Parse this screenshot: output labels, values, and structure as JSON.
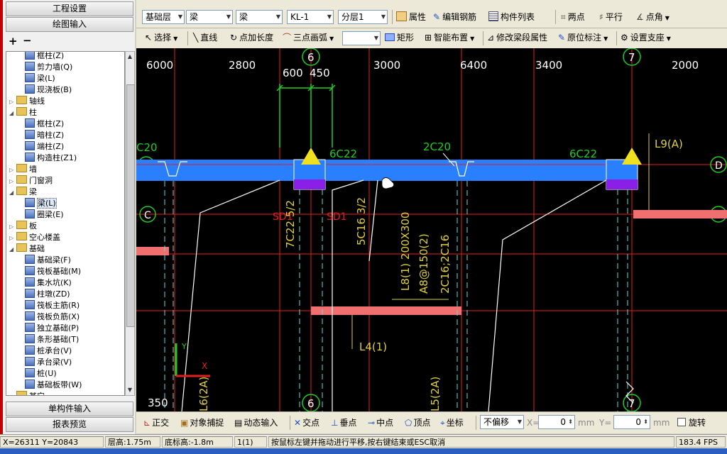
{
  "left_panel": {
    "top_buttons": [
      "工程设置",
      "绘图输入"
    ],
    "add_icon": "+",
    "remove_icon": "−",
    "bottom_buttons": [
      "单构件输入",
      "报表预览"
    ],
    "tree": [
      {
        "label": "框柱(Z)",
        "level": 2,
        "icon": "column-icon"
      },
      {
        "label": "剪力墙(Q)",
        "level": 2,
        "icon": "wall-icon"
      },
      {
        "label": "梁(L)",
        "level": 2,
        "icon": "beam-icon"
      },
      {
        "label": "现浇板(B)",
        "level": 2,
        "icon": "slab-icon"
      },
      {
        "label": "轴线",
        "level": 1,
        "icon": "folder-icon",
        "toggle": "▷"
      },
      {
        "label": "柱",
        "level": 1,
        "icon": "folder-icon",
        "toggle": "◢"
      },
      {
        "label": "框柱(Z)",
        "level": 2,
        "icon": "column-icon"
      },
      {
        "label": "暗柱(Z)",
        "level": 2,
        "icon": "column-icon"
      },
      {
        "label": "端柱(Z)",
        "level": 2,
        "icon": "column-icon"
      },
      {
        "label": "构造柱(Z1)",
        "level": 2,
        "icon": "column-icon"
      },
      {
        "label": "墙",
        "level": 1,
        "icon": "folder-icon",
        "toggle": "▷"
      },
      {
        "label": "门窗洞",
        "level": 1,
        "icon": "folder-icon",
        "toggle": "▷"
      },
      {
        "label": "梁",
        "level": 1,
        "icon": "folder-icon",
        "toggle": "◢"
      },
      {
        "label": "梁(L)",
        "level": 2,
        "icon": "beam-icon",
        "selected": true
      },
      {
        "label": "圈梁(E)",
        "level": 2,
        "icon": "beam-icon"
      },
      {
        "label": "板",
        "level": 1,
        "icon": "folder-icon",
        "toggle": "▷"
      },
      {
        "label": "空心楼盖",
        "level": 1,
        "icon": "folder-icon",
        "toggle": "▷"
      },
      {
        "label": "基础",
        "level": 1,
        "icon": "folder-icon",
        "toggle": "◢"
      },
      {
        "label": "基础梁(F)",
        "level": 2,
        "icon": "grid-icon"
      },
      {
        "label": "筏板基础(M)",
        "level": 2,
        "icon": "grid-icon"
      },
      {
        "label": "集水坑(K)",
        "level": 2,
        "icon": "pit-icon"
      },
      {
        "label": "柱墩(ZD)",
        "level": 2,
        "icon": "pier-icon"
      },
      {
        "label": "筏板主筋(R)",
        "level": 2,
        "icon": "grid-icon"
      },
      {
        "label": "筏板负筋(X)",
        "level": 2,
        "icon": "grid-icon"
      },
      {
        "label": "独立基础(P)",
        "level": 2,
        "icon": "footing-icon"
      },
      {
        "label": "条形基础(T)",
        "level": 2,
        "icon": "strip-icon"
      },
      {
        "label": "桩承台(V)",
        "level": 2,
        "icon": "cap-icon"
      },
      {
        "label": "承台梁(V)",
        "level": 2,
        "icon": "beam-icon"
      },
      {
        "label": "桩(U)",
        "level": 2,
        "icon": "pile-icon"
      },
      {
        "label": "基础板带(W)",
        "level": 2,
        "icon": "grid-icon"
      },
      {
        "label": "其它",
        "level": 1,
        "icon": "folder-icon",
        "toggle": "▷"
      }
    ]
  },
  "toolbar1": {
    "floor": "基础层",
    "category": "梁",
    "type": "梁",
    "component": "KL-1",
    "layer": "分层1",
    "btn_props": "属性",
    "btn_edit_rebar": "编辑钢筋",
    "btn_list": "构件列表",
    "btn_two_point": "两点",
    "btn_parallel": "平行",
    "btn_point_angle": "点角"
  },
  "toolbar2": {
    "select": "选择",
    "line": "直线",
    "point_length": "点加长度",
    "arc": "三点画弧",
    "rect": "矩形",
    "smart": "智能布置",
    "modify_seg": "修改梁段属性",
    "in_place": "原位标注",
    "support": "设置支座"
  },
  "canvas": {
    "dims_top": [
      "6000",
      "2800",
      "600",
      "450",
      "3000",
      "6400",
      "3400",
      "2000"
    ],
    "axis_6": "6",
    "axis_7": "7",
    "axis_D": "D",
    "axis_C": "C",
    "labels": {
      "c20_left": "C20",
      "c6c22_a": "6C22",
      "c2c20": "2C20",
      "c6c22_b": "6C22",
      "l9": "L9(A)",
      "sd1_a": "SD1",
      "sd1_b": "SD1",
      "r7c22": "7C22 5/2",
      "r5c16": "5C16 3/2",
      "l8_a": "L8(1) 200X300",
      "l8_b": "A8@150(2)",
      "l8_c": "2C16;2C16",
      "l4": "L4(1)",
      "l6": "L6(2A)",
      "l5": "L5(2A)",
      "n350": "350",
      "ucs_y": "Y",
      "ucs_x": "X"
    }
  },
  "snapbar": {
    "ortho": "正交",
    "obj_snap": "对象捕捉",
    "dyn_input": "动态输入",
    "intersect": "交点",
    "perp": "垂点",
    "mid": "中点",
    "vertex": "顶点",
    "coord": "坐标",
    "offset": "不偏移",
    "x_label": "X=",
    "x_val": "0",
    "mm1": "mm",
    "y_label": "Y=",
    "y_val": "0",
    "mm2": "mm",
    "rotate": "旋转"
  },
  "statusbar": {
    "coords": "X=26311 Y=20843",
    "floor_h": "层高:1.75m",
    "bottom_h": "底标高:-1.8m",
    "count": "1(1)",
    "hint": "按鼠标左键并拖动进行平移,按右键结束或ESC取消",
    "fps": "183.4 FPS"
  },
  "colors": {
    "canvas_bg": "#000000",
    "axis_red": "#e02020",
    "beam_blue": "#2a7fff",
    "rebar_green": "#22cc22",
    "label_yellow": "#e0d040",
    "white_line": "#ffffff",
    "cyan_dash": "#66dddd"
  }
}
